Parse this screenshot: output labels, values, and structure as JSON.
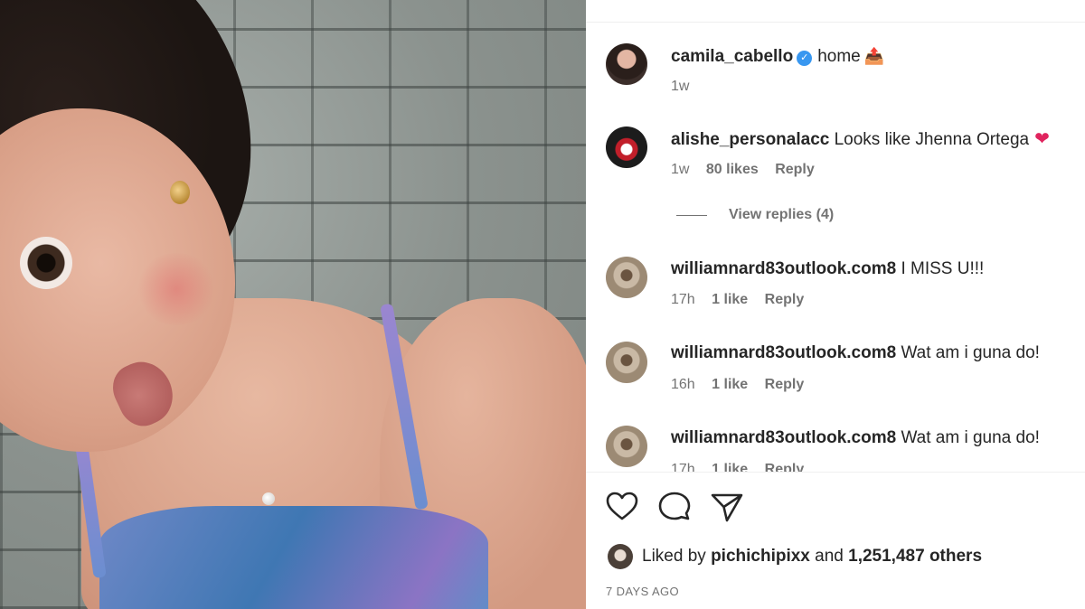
{
  "post": {
    "owner": {
      "username": "camila_cabello",
      "verified": true,
      "caption": "home",
      "caption_emoji": "📤",
      "time": "1w"
    }
  },
  "comments": [
    {
      "username": "alishe_personalacc",
      "text": "Looks like Jhenna Ortega",
      "emoji": "❤",
      "time": "1w",
      "likes": "80 likes",
      "reply_label": "Reply",
      "view_replies": "View replies (4)"
    },
    {
      "username": "williamnard83outlook.com8",
      "text": "I MISS U!!!",
      "time": "17h",
      "likes": "1 like",
      "reply_label": "Reply"
    },
    {
      "username": "williamnard83outlook.com8",
      "text": "Wat am i guna do!",
      "time": "16h",
      "likes": "1 like",
      "reply_label": "Reply"
    },
    {
      "username": "williamnard83outlook.com8",
      "text": "Wat am i guna do!",
      "time": "17h",
      "likes": "1 like",
      "reply_label": "Reply"
    }
  ],
  "actions": {
    "icons": [
      "heart-icon",
      "comment-icon",
      "share-icon"
    ]
  },
  "likes": {
    "prefix": "Liked by",
    "user": "pichichipixx",
    "connector": "and",
    "count": "1,251,487 others"
  },
  "date": "7 DAYS AGO"
}
